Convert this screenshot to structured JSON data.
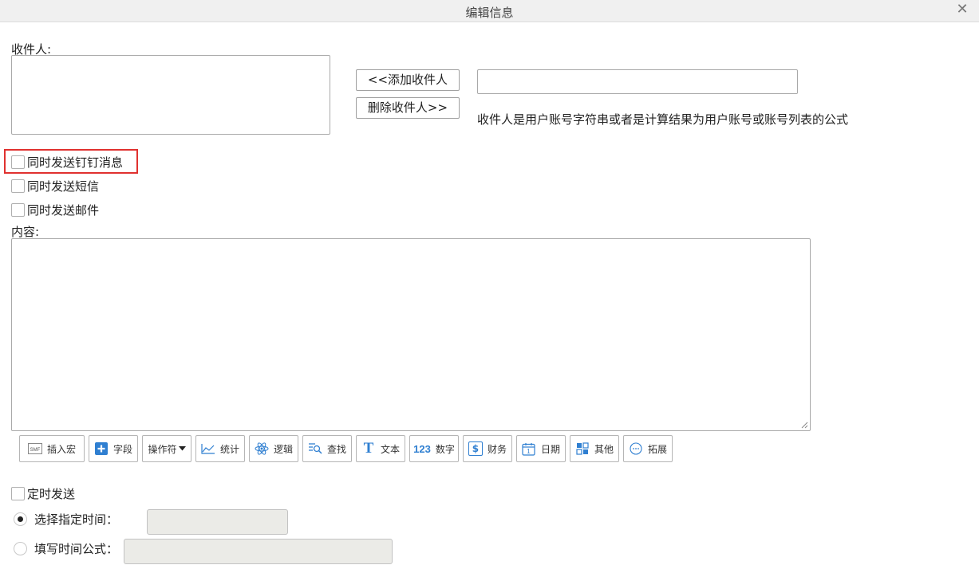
{
  "window": {
    "title": "编辑信息",
    "close_icon": "close-icon"
  },
  "recipient": {
    "label": "收件人:",
    "add_button": "<<添加收件人",
    "remove_button": "删除收件人>>",
    "input_value": "",
    "hint": "收件人是用户账号字符串或者是计算结果为用户账号或账号列表的公式"
  },
  "options": {
    "dingtalk": {
      "label": "同时发送钉钉消息",
      "checked": false
    },
    "sms": {
      "label": "同时发送短信",
      "checked": false
    },
    "email": {
      "label": "同时发送邮件",
      "checked": false
    }
  },
  "content": {
    "label": "内容:",
    "value": ""
  },
  "toolbar": {
    "items": [
      {
        "label": "插入宏",
        "icon": "smf-macro-icon",
        "icon_text": "SMF"
      },
      {
        "label": "字段",
        "icon": "plus-field-icon"
      },
      {
        "label": "操作符",
        "icon": "dropdown-caret-icon"
      },
      {
        "label": "统计",
        "icon": "line-chart-icon"
      },
      {
        "label": "逻辑",
        "icon": "atom-logic-icon"
      },
      {
        "label": "查找",
        "icon": "search-list-icon"
      },
      {
        "label": "文本",
        "icon": "text-t-icon",
        "icon_text": "T"
      },
      {
        "label": "数字",
        "icon": "number-123-icon",
        "icon_text": "123"
      },
      {
        "label": "财务",
        "icon": "dollar-icon",
        "icon_text": "$"
      },
      {
        "label": "日期",
        "icon": "calendar-icon",
        "icon_text": "1"
      },
      {
        "label": "其他",
        "icon": "grid-icon"
      },
      {
        "label": "拓展",
        "icon": "ellipsis-circle-icon"
      }
    ]
  },
  "schedule": {
    "label": "定时发送",
    "checked": false,
    "specific_time": {
      "label": "选择指定时间：",
      "selected": true,
      "value": ""
    },
    "time_formula": {
      "label": "填写时间公式：",
      "selected": false,
      "value": ""
    }
  },
  "colors": {
    "highlight": "#e0312f",
    "icon_blue": "#2f7fd1",
    "disabled_bg": "#ebebe7"
  }
}
